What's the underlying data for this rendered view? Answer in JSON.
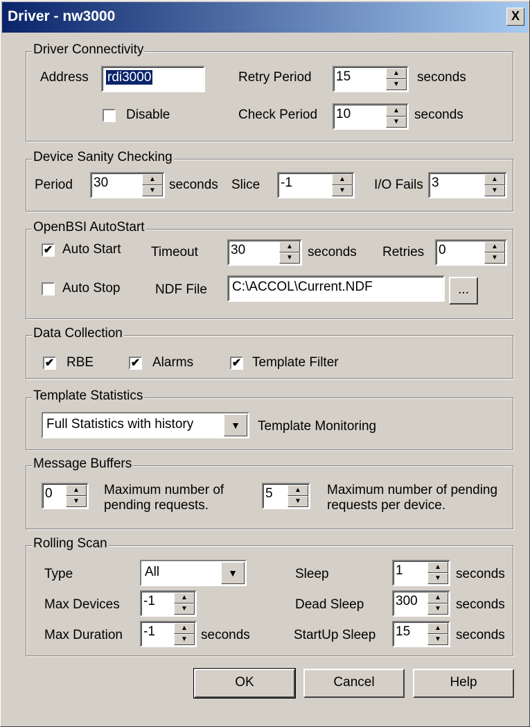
{
  "window": {
    "title": "Driver - nw3000",
    "close_glyph": "X"
  },
  "connectivity": {
    "legend": "Driver Connectivity",
    "address_label": "Address",
    "address_value": "rdi3000",
    "retry_label": "Retry Period",
    "retry_value": "15",
    "seconds1": "seconds",
    "disable_label": "Disable",
    "check_label": "Check Period",
    "check_value": "10",
    "seconds2": "seconds"
  },
  "sanity": {
    "legend": "Device Sanity Checking",
    "period_label": "Period",
    "period_value": "30",
    "seconds": "seconds",
    "slice_label": "Slice",
    "slice_value": "-1",
    "io_label": "I/O Fails",
    "io_value": "3"
  },
  "autostart": {
    "legend": "OpenBSI AutoStart",
    "auto_start_label": "Auto Start",
    "timeout_label": "Timeout",
    "timeout_value": "30",
    "seconds": "seconds",
    "retries_label": "Retries",
    "retries_value": "0",
    "auto_stop_label": "Auto Stop",
    "ndf_label": "NDF File",
    "ndf_value": "C:\\ACCOL\\Current.NDF",
    "browse_label": "..."
  },
  "collection": {
    "legend": "Data Collection",
    "rbe_label": "RBE",
    "alarms_label": "Alarms",
    "template_filter_label": "Template Filter"
  },
  "template_stats": {
    "legend": "Template Statistics",
    "combo_value": "Full Statistics with history",
    "monitoring_label": "Template Monitoring"
  },
  "buffers": {
    "legend": "Message Buffers",
    "pending_value": "0",
    "pending_line1": "Maximum number of",
    "pending_line2": "pending requests.",
    "device_value": "5",
    "device_line1": "Maximum number of pending",
    "device_line2": "requests per device."
  },
  "rolling": {
    "legend": "Rolling Scan",
    "type_label": "Type",
    "type_value": "All",
    "max_devices_label": "Max Devices",
    "max_devices_value": "-1",
    "max_duration_label": "Max Duration",
    "max_duration_value": "-1",
    "seconds_duration": "seconds",
    "sleep_label": "Sleep",
    "sleep_value": "1",
    "sleep_seconds": "seconds",
    "dead_sleep_label": "Dead Sleep",
    "dead_sleep_value": "300",
    "dead_seconds": "seconds",
    "startup_label": "StartUp Sleep",
    "startup_value": "15",
    "startup_seconds": "seconds"
  },
  "buttons": {
    "ok": "OK",
    "cancel": "Cancel",
    "help": "Help"
  },
  "icons": {
    "check": "✔",
    "up": "▲",
    "down": "▼",
    "dropdown": "▼"
  }
}
